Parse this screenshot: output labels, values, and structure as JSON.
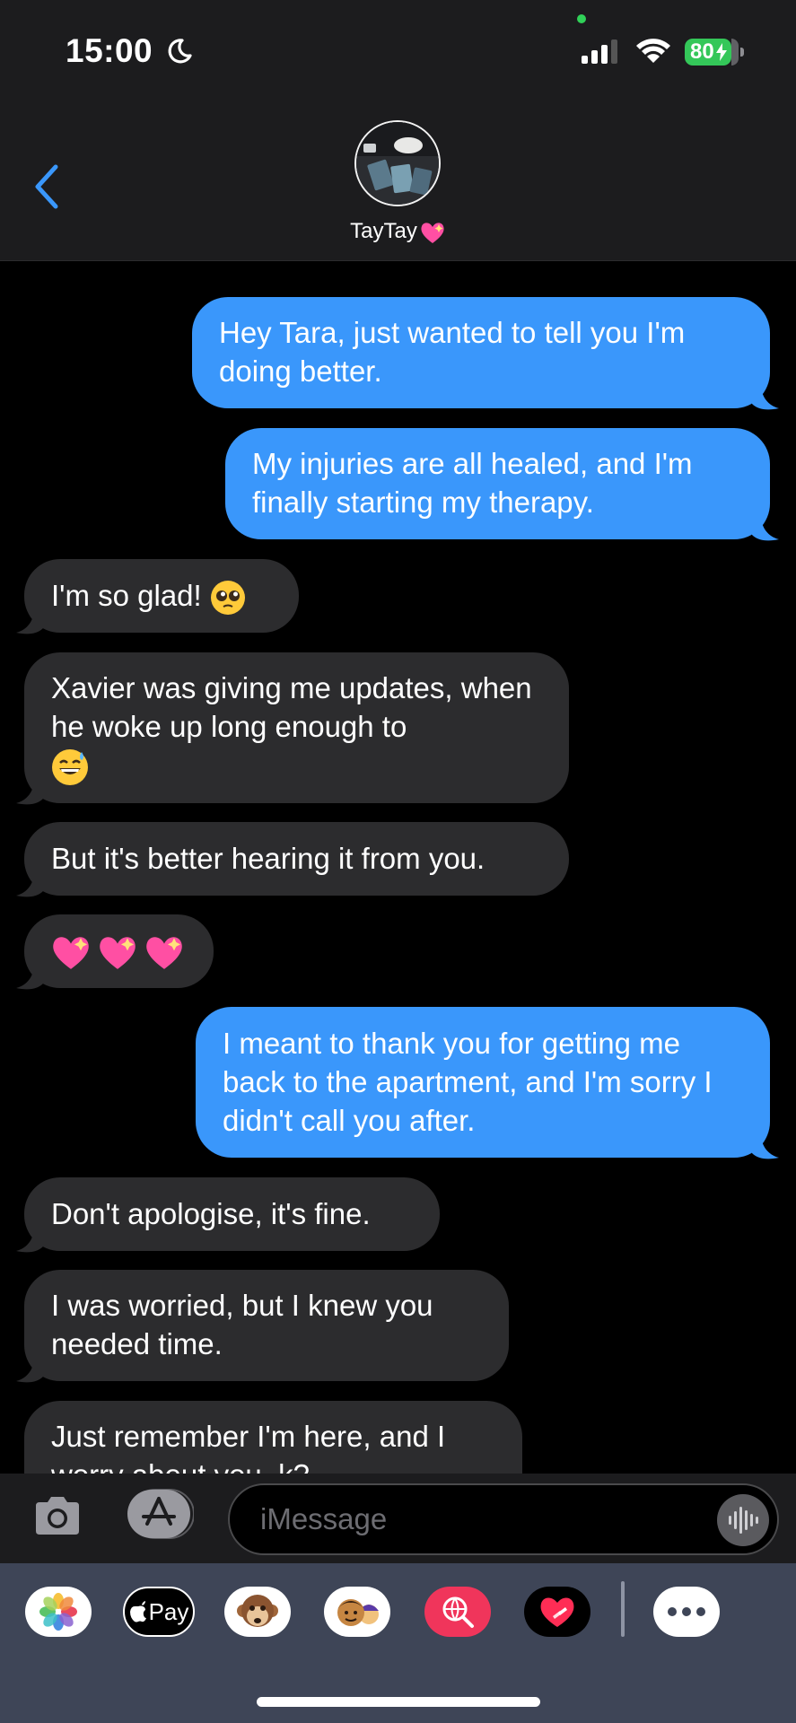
{
  "status_bar": {
    "time": "15:00",
    "battery": "80"
  },
  "contact": {
    "name": "TayTay"
  },
  "messages": [
    {
      "dir": "out",
      "text": "Hey Tara, just wanted to tell you I'm doing better."
    },
    {
      "dir": "out",
      "text": "My injuries are all healed, and I'm finally starting my therapy."
    },
    {
      "dir": "in",
      "text": "I'm so glad! ",
      "emoji": "pleading-face"
    },
    {
      "dir": "in",
      "text": "Xavier was giving me updates, when he woke up long enough to",
      "emoji": "grinning-sweat-face"
    },
    {
      "dir": "in",
      "text": "But it's better hearing it from you."
    },
    {
      "dir": "in",
      "text": "",
      "emoji": "sparkling-heart x3"
    },
    {
      "dir": "out",
      "text": "I meant to thank you for getting me back to the apartment, and I'm sorry I didn't call you after."
    },
    {
      "dir": "in",
      "text": "Don't apologise, it's fine."
    },
    {
      "dir": "in",
      "text": "I was worried, but I knew you needed time."
    },
    {
      "dir": "in",
      "text": "Just remember I'm here, and I worry about you, k?"
    }
  ],
  "input": {
    "placeholder": "iMessage"
  },
  "apps": {
    "apple_pay": "Pay"
  },
  "colors": {
    "outgoing": "#3a97fb",
    "incoming": "#2c2c2e",
    "tray": "#3e4557"
  }
}
